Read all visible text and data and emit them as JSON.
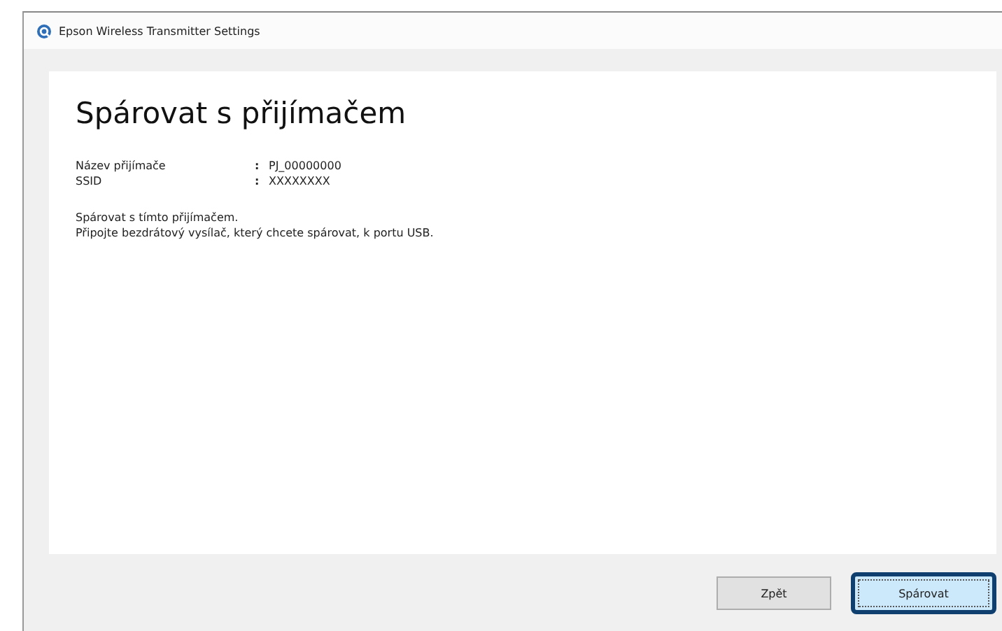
{
  "window": {
    "title": "Epson Wireless Transmitter Settings"
  },
  "heading": "Spárovat s přijímačem",
  "info": [
    {
      "label": "Název přijímače",
      "separator": ":",
      "value": "PJ_00000000"
    },
    {
      "label": "SSID",
      "separator": ":",
      "value": "XXXXXXXX"
    }
  ],
  "message": [
    "Spárovat s tímto přijímačem.",
    "Připojte bezdrátový vysílač, který chcete spárovat, k portu USB."
  ],
  "buttons": [
    {
      "label": "Zpět",
      "focused": false
    },
    {
      "label": "Spárovat",
      "focused": true
    }
  ]
}
